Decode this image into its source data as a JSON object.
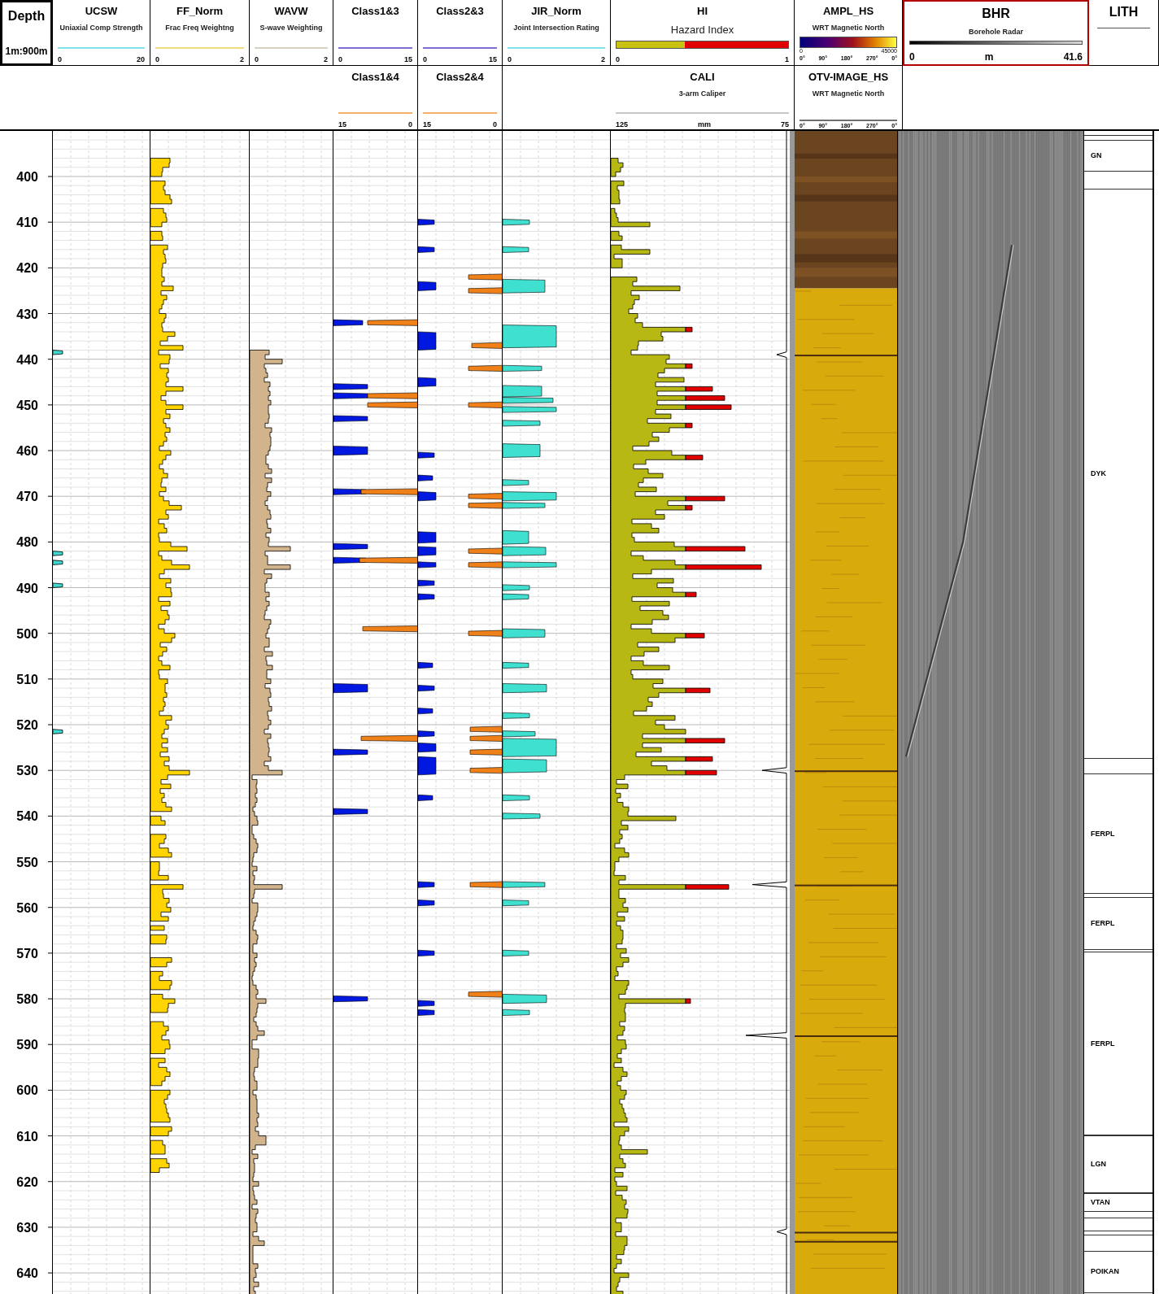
{
  "depth_header": {
    "title": "Depth",
    "scale": "1m:900m"
  },
  "tracks": [
    {
      "kind": "curve",
      "title": "UCSW",
      "subtitle": "Uniaxial Comp Strength",
      "color": "#7fe5ea",
      "min": "0",
      "max": "20"
    },
    {
      "kind": "curve",
      "title": "FF_Norm",
      "subtitle": "Frac Freq Weightng",
      "color": "#f0dc7a",
      "min": "0",
      "max": "2"
    },
    {
      "kind": "curve",
      "title": "WAVW",
      "subtitle": "S-wave Weighting",
      "color": "#d8d0c0",
      "min": "0",
      "max": "2"
    },
    {
      "kind": "curve",
      "title": "Class1&3",
      "color": "#7b6fd6",
      "min": "0",
      "max": "15"
    },
    {
      "kind": "curve",
      "title": "Class2&3",
      "color": "#7b6fd6",
      "min": "0",
      "max": "15"
    },
    {
      "kind": "curve",
      "title": "JIR_Norm",
      "subtitle": "Joint Intersection Rating",
      "color": "#7fe5ea",
      "min": "0",
      "max": "2"
    },
    {
      "kind": "hazard",
      "title": "HI",
      "subtitle": "Hazard Index",
      "min": "0",
      "max": "1"
    },
    {
      "kind": "amplitude",
      "title": "AMPL_HS",
      "subtitle": "WRT Magnetic North",
      "min": "0",
      "max": "45000",
      "degrees": [
        "0°",
        "90°",
        "180°",
        "270°",
        "0°"
      ]
    },
    {
      "kind": "radar",
      "title": "BHR",
      "subtitle": "Borehole Radar",
      "min": "0",
      "unit": "m",
      "max": "41.6"
    },
    {
      "kind": "lith",
      "title": "LITH"
    }
  ],
  "second_row": [
    {
      "kind": "empty"
    },
    {
      "kind": "empty"
    },
    {
      "kind": "empty"
    },
    {
      "kind": "empty"
    },
    {
      "kind": "curve",
      "title": "Class1&4",
      "color": "#f5b070",
      "min": "15",
      "max": "0"
    },
    {
      "kind": "curve",
      "title": "Class2&4",
      "color": "#f5b070",
      "min": "15",
      "max": "0"
    },
    {
      "kind": "empty"
    },
    {
      "kind": "caliper",
      "title": "CALI",
      "subtitle": "3-arm Caliper",
      "color": "#c8c8c8",
      "min": "125",
      "unit": "mm",
      "max": "75"
    },
    {
      "kind": "image",
      "title": "OTV-IMAGE_HS",
      "subtitle": "WRT Magnetic North",
      "color": "#707070",
      "degrees": [
        "0°",
        "90°",
        "180°",
        "270°",
        "0°"
      ]
    },
    {
      "kind": "empty"
    },
    {
      "kind": "empty"
    }
  ],
  "depth_labels": [
    "400",
    "410",
    "420",
    "430",
    "440",
    "450",
    "460",
    "470",
    "480",
    "490",
    "500",
    "510",
    "520",
    "530",
    "540",
    "550",
    "560",
    "570",
    "580",
    "590",
    "600",
    "610",
    "620",
    "630",
    "640"
  ],
  "lithology": [
    {
      "label": "GN"
    },
    {
      "label": "DYK"
    },
    {
      "label": "FERPL"
    },
    {
      "label": "FERPL"
    },
    {
      "label": "FERPL"
    },
    {
      "label": "LGN"
    },
    {
      "label": "VTAN"
    },
    {
      "label": "POIKAN"
    }
  ]
}
